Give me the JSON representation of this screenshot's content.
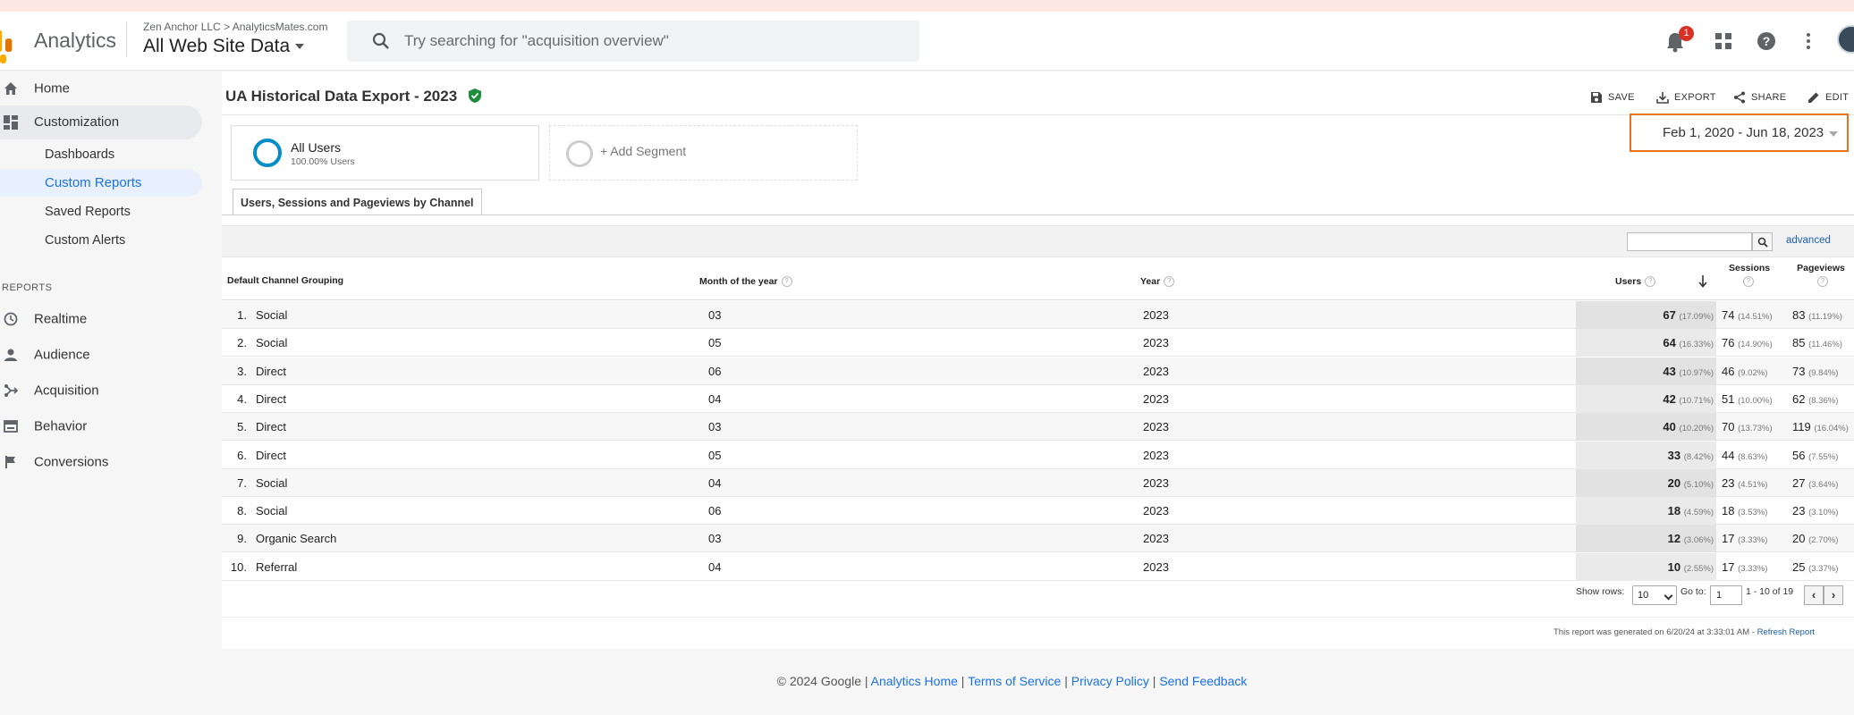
{
  "header": {
    "app_name": "Analytics",
    "account": "Zen Anchor LLC",
    "account_sep": ">",
    "property": "AnalyticsMates.com",
    "view": "All Web Site Data",
    "search_placeholder": "Try searching for \"acquisition overview\"",
    "notification_count": "1",
    "colors": {
      "logo": "#f9ab00",
      "badge": "#d93025"
    }
  },
  "sidebar": {
    "home": "Home",
    "customization": "Customization",
    "sub_items": [
      "Dashboards",
      "Custom Reports",
      "Saved Reports",
      "Custom Alerts"
    ],
    "reports_header": "REPORTS",
    "reports": [
      "Realtime",
      "Audience",
      "Acquisition",
      "Behavior",
      "Conversions"
    ]
  },
  "report": {
    "title": "UA Historical Data Export - 2023",
    "actions": {
      "save": "SAVE",
      "export": "EXPORT",
      "share": "SHARE",
      "edit": "EDIT"
    },
    "segment": {
      "name": "All Users",
      "sub": "100.00% Users"
    },
    "add_segment": "+ Add Segment",
    "date_range": "Feb 1, 2020 - Jun 18, 2023",
    "tab": "Users, Sessions and Pageviews by Channel",
    "advanced": "advanced",
    "columns": {
      "channel": "Default Channel Grouping",
      "month": "Month of the year",
      "year": "Year",
      "users": "Users",
      "sessions": "Sessions",
      "pageviews": "Pageviews"
    },
    "rows": [
      {
        "idx": "1.",
        "channel": "Social",
        "month": "03",
        "year": "2023",
        "users": "67",
        "users_pct": "(17.09%)",
        "sessions": "74",
        "sessions_pct": "(14.51%)",
        "pageviews": "83",
        "pageviews_pct": "(11.19%)"
      },
      {
        "idx": "2.",
        "channel": "Social",
        "month": "05",
        "year": "2023",
        "users": "64",
        "users_pct": "(16.33%)",
        "sessions": "76",
        "sessions_pct": "(14.90%)",
        "pageviews": "85",
        "pageviews_pct": "(11.46%)"
      },
      {
        "idx": "3.",
        "channel": "Direct",
        "month": "06",
        "year": "2023",
        "users": "43",
        "users_pct": "(10.97%)",
        "sessions": "46",
        "sessions_pct": "(9.02%)",
        "pageviews": "73",
        "pageviews_pct": "(9.84%)"
      },
      {
        "idx": "4.",
        "channel": "Direct",
        "month": "04",
        "year": "2023",
        "users": "42",
        "users_pct": "(10.71%)",
        "sessions": "51",
        "sessions_pct": "(10.00%)",
        "pageviews": "62",
        "pageviews_pct": "(8.36%)"
      },
      {
        "idx": "5.",
        "channel": "Direct",
        "month": "03",
        "year": "2023",
        "users": "40",
        "users_pct": "(10.20%)",
        "sessions": "70",
        "sessions_pct": "(13.73%)",
        "pageviews": "119",
        "pageviews_pct": "(16.04%)"
      },
      {
        "idx": "6.",
        "channel": "Direct",
        "month": "05",
        "year": "2023",
        "users": "33",
        "users_pct": "(8.42%)",
        "sessions": "44",
        "sessions_pct": "(8.63%)",
        "pageviews": "56",
        "pageviews_pct": "(7.55%)"
      },
      {
        "idx": "7.",
        "channel": "Social",
        "month": "04",
        "year": "2023",
        "users": "20",
        "users_pct": "(5.10%)",
        "sessions": "23",
        "sessions_pct": "(4.51%)",
        "pageviews": "27",
        "pageviews_pct": "(3.64%)"
      },
      {
        "idx": "8.",
        "channel": "Social",
        "month": "06",
        "year": "2023",
        "users": "18",
        "users_pct": "(4.59%)",
        "sessions": "18",
        "sessions_pct": "(3.53%)",
        "pageviews": "23",
        "pageviews_pct": "(3.10%)"
      },
      {
        "idx": "9.",
        "channel": "Organic Search",
        "month": "03",
        "year": "2023",
        "users": "12",
        "users_pct": "(3.06%)",
        "sessions": "17",
        "sessions_pct": "(3.33%)",
        "pageviews": "20",
        "pageviews_pct": "(2.70%)"
      },
      {
        "idx": "10.",
        "channel": "Referral",
        "month": "04",
        "year": "2023",
        "users": "10",
        "users_pct": "(2.55%)",
        "sessions": "17",
        "sessions_pct": "(3.33%)",
        "pageviews": "25",
        "pageviews_pct": "(3.37%)"
      }
    ],
    "pagination": {
      "show_rows_label": "Show rows:",
      "show_rows_value": "10",
      "goto_label": "Go to:",
      "goto_value": "1",
      "range": "1 - 10 of 19"
    },
    "generated": "This report was generated on 6/20/24 at 3:33:01 AM - ",
    "refresh": "Refresh Report"
  },
  "footer": {
    "copyright": "© 2024 Google | ",
    "links": [
      "Analytics Home",
      "Terms of Service",
      "Privacy Policy",
      "Send Feedback"
    ],
    "sep": " | "
  }
}
